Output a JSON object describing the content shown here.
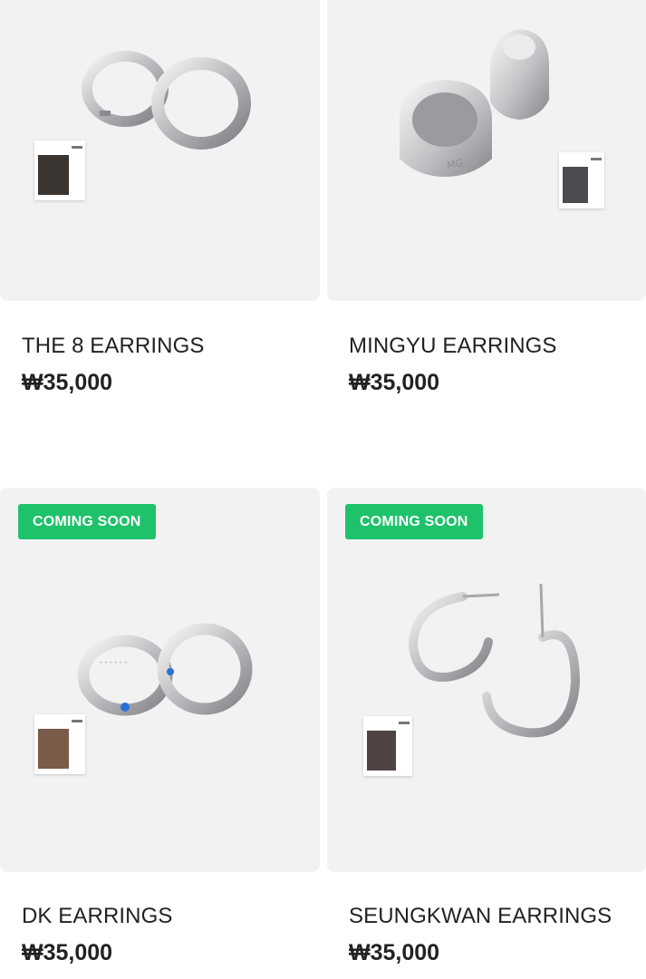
{
  "products": [
    {
      "name": "THE 8 EARRINGS",
      "price": "₩35,000",
      "badge": ""
    },
    {
      "name": "MINGYU EARRINGS",
      "price": "₩35,000",
      "badge": ""
    },
    {
      "name": "DK EARRINGS",
      "price": "₩35,000",
      "badge": "COMING SOON"
    },
    {
      "name": "SEUNGKWAN EARRINGS",
      "price": "₩35,000",
      "badge": "COMING SOON"
    }
  ],
  "colors": {
    "badge": "#1ec26a",
    "thumb_bg": "#f2f2f3",
    "text": "#222222"
  }
}
